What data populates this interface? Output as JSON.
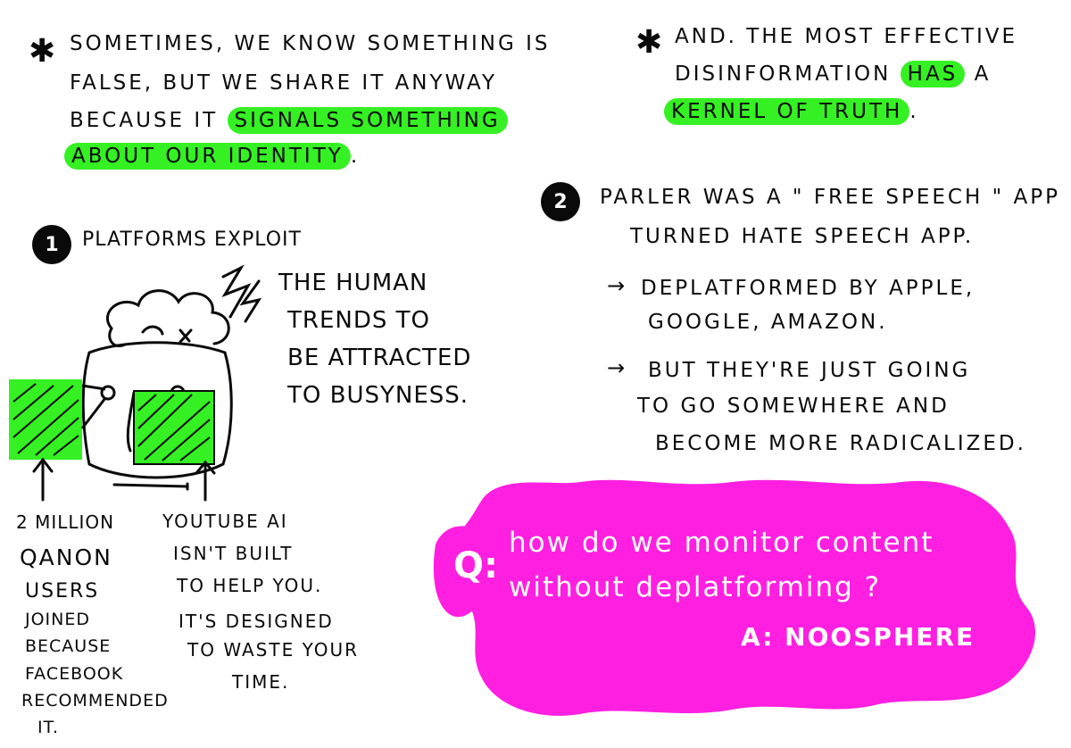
{
  "left_note": {
    "line1": "Sometimes, we know something is",
    "line2": "false, but we share it anyway",
    "line3_pre": "because it",
    "line3_hl": "signals something",
    "line4_hl": "about our identity",
    "line4_post": "."
  },
  "right_note": {
    "line1": "And. The most effective",
    "line2_pre": "disinformation",
    "line2_hl": "has",
    "line2_post": "a",
    "line3_hl": "kernel of truth",
    "line3_post": "."
  },
  "section1": {
    "number": "1",
    "title": "Platforms exploit",
    "callout": [
      "The human",
      "trends to",
      "be attracted",
      "to busyness."
    ],
    "qanon": [
      "2 million",
      "QAnon",
      "users",
      "joined",
      "because",
      "Facebook",
      "recommended",
      "it."
    ],
    "youtube": [
      "YouTube AI",
      "isn't built",
      "to help you.",
      "It's designed",
      "to waste your",
      "time."
    ]
  },
  "section2": {
    "number": "2",
    "line1": "Parler was a \" free speech \" app",
    "line2": "turned   hate speech app.",
    "bullet1": [
      "deplatformed by apple,",
      "Google, Amazon."
    ],
    "bullet2": [
      "But they're just going",
      "to go somewhere and",
      "become more radicalized."
    ]
  },
  "qa": {
    "q_label": "Q:",
    "question_line1": "how do we monitor content",
    "question_line2": "without deplatforming ?",
    "answer": "A: NOOSPHERE"
  },
  "colors": {
    "highlight": "#35f023",
    "magenta": "#ff1fe0",
    "ink": "#0a0a0a"
  }
}
